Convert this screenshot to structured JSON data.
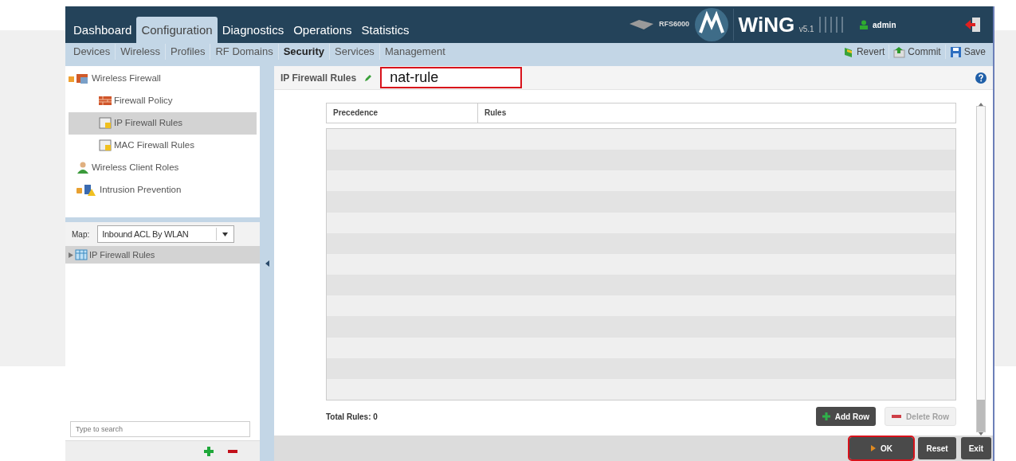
{
  "main_tabs": [
    {
      "label": "Dashboard",
      "selected": false
    },
    {
      "label": "Configuration",
      "selected": true
    },
    {
      "label": "Diagnostics",
      "selected": false
    },
    {
      "label": "Operations",
      "selected": false
    },
    {
      "label": "Statistics",
      "selected": false
    }
  ],
  "device": "RFS6000",
  "product": "WiNG",
  "version": "v5.1",
  "user": "admin",
  "sub_tabs": [
    {
      "label": "Devices",
      "selected": false
    },
    {
      "label": "Wireless",
      "selected": false
    },
    {
      "label": "Profiles",
      "selected": false
    },
    {
      "label": "RF Domains",
      "selected": false
    },
    {
      "label": "Security",
      "selected": true
    },
    {
      "label": "Services",
      "selected": false
    },
    {
      "label": "Management",
      "selected": false
    }
  ],
  "actions": [
    {
      "kind": "revert",
      "label": "Revert"
    },
    {
      "kind": "commit",
      "label": "Commit"
    },
    {
      "kind": "save",
      "label": "Save"
    }
  ],
  "tree": [
    {
      "label": "Wireless Firewall",
      "kind": "firewall",
      "expanded": true,
      "selected": false,
      "children": [
        {
          "label": "Firewall Policy",
          "kind": "policy",
          "selected": false
        },
        {
          "label": "IP Firewall Rules",
          "kind": "rules",
          "selected": true
        },
        {
          "label": "MAC Firewall Rules",
          "kind": "rules",
          "selected": false
        }
      ]
    },
    {
      "label": "Wireless Client Roles",
      "kind": "user",
      "selected": false
    },
    {
      "label": "Intrusion Prevention",
      "kind": "ips",
      "expanded": false,
      "selected": false
    }
  ],
  "map": {
    "label": "Map:",
    "value": "Inbound ACL By WLAN",
    "items": [
      {
        "label": "IP Firewall Rules",
        "expanded": false
      }
    ]
  },
  "search": {
    "placeholder": "Type to search"
  },
  "panel": {
    "title": "IP Firewall Rules",
    "name_value": "nat-rule",
    "name_highlighted": true
  },
  "table": {
    "columns": [
      "Precedence",
      "Rules"
    ]
  },
  "total": "Total Rules: 0",
  "table_buttons": [
    {
      "label": "Add Row",
      "kind": "add",
      "disabled": false
    },
    {
      "label": "Delete Row",
      "kind": "delete",
      "disabled": true
    }
  ],
  "footer_buttons": [
    {
      "label": "OK",
      "highlighted": true
    },
    {
      "label": "Reset",
      "highlighted": false
    },
    {
      "label": "Exit",
      "highlighted": false
    }
  ]
}
